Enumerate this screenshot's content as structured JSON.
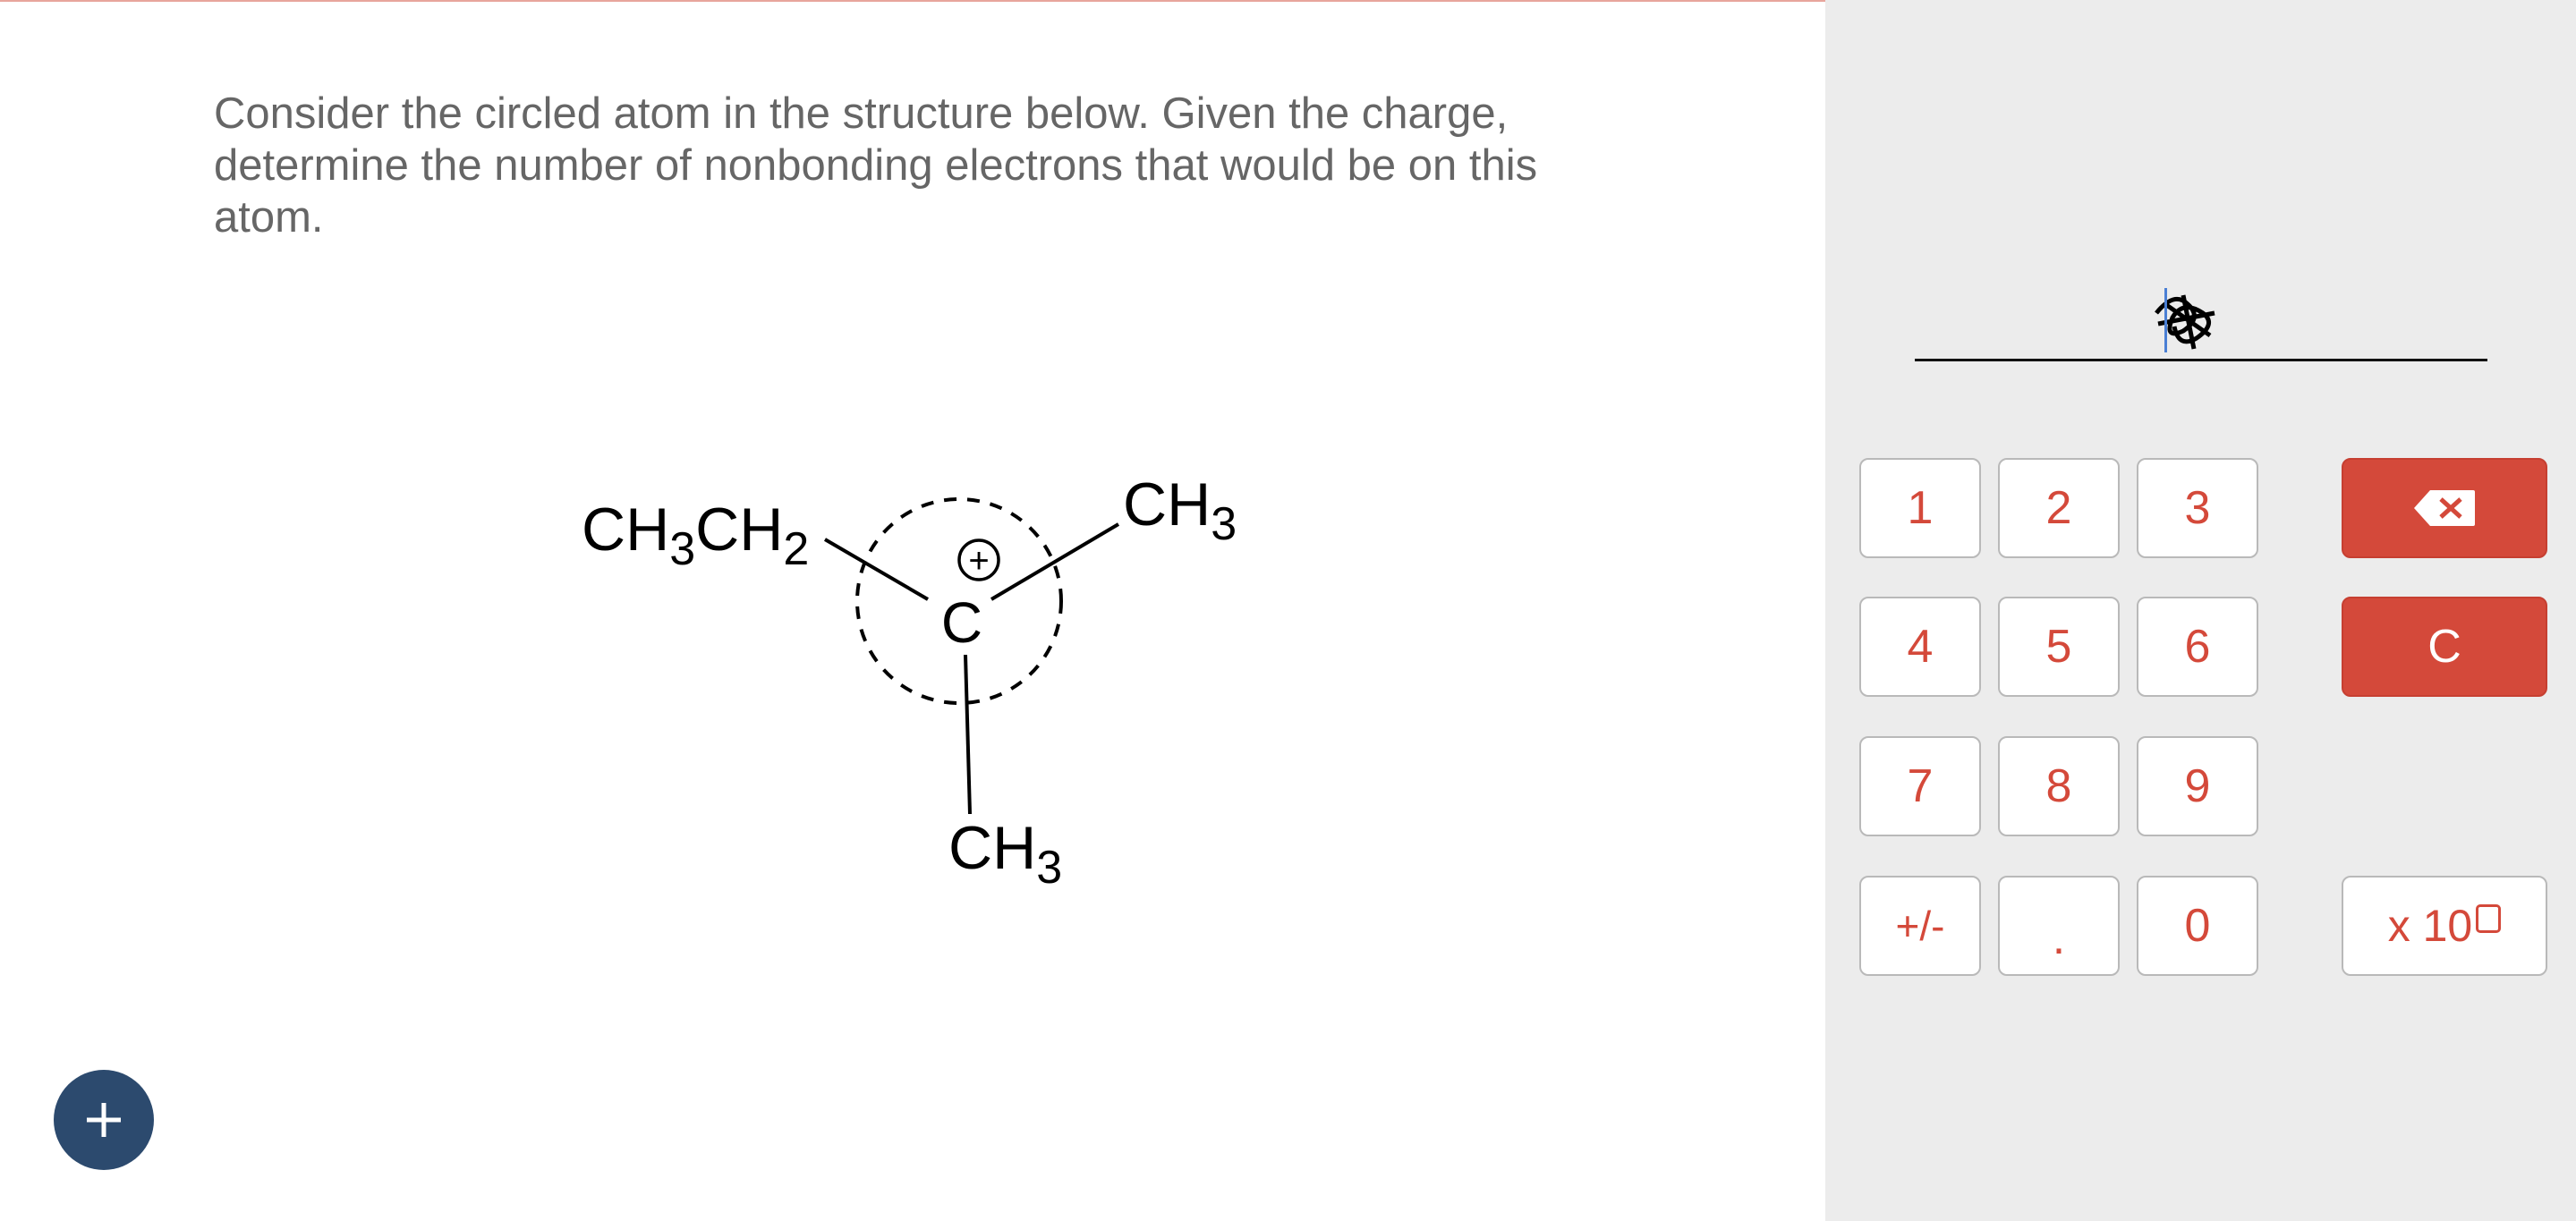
{
  "question": {
    "text": "Consider the circled atom in the structure below. Given the charge, determine the number of nonbonding electrons that would be on this atom."
  },
  "structure": {
    "left_group": {
      "base": "CH",
      "sub1": "3",
      "mid": "CH",
      "sub2": "2"
    },
    "right_group": {
      "base": "CH",
      "sub": "3"
    },
    "bottom_group": {
      "base": "CH",
      "sub": "3"
    },
    "center_atom": "C",
    "charge": "+"
  },
  "fab": {
    "icon": "plus-icon",
    "label": "+"
  },
  "answer": {
    "value": ""
  },
  "keypad": {
    "digits_row1": [
      "1",
      "2",
      "3"
    ],
    "digits_row2": [
      "4",
      "5",
      "6"
    ],
    "digits_row3": [
      "7",
      "8",
      "9"
    ],
    "row4": {
      "sign": "+/-",
      "decimal": ".",
      "zero": "0"
    },
    "backspace_icon": "backspace-icon",
    "clear": "C",
    "sci": "x 10"
  },
  "colors": {
    "accent": "#d4493a",
    "fab": "#2c4a6e",
    "panel": "#ececec",
    "text": "#666666"
  }
}
